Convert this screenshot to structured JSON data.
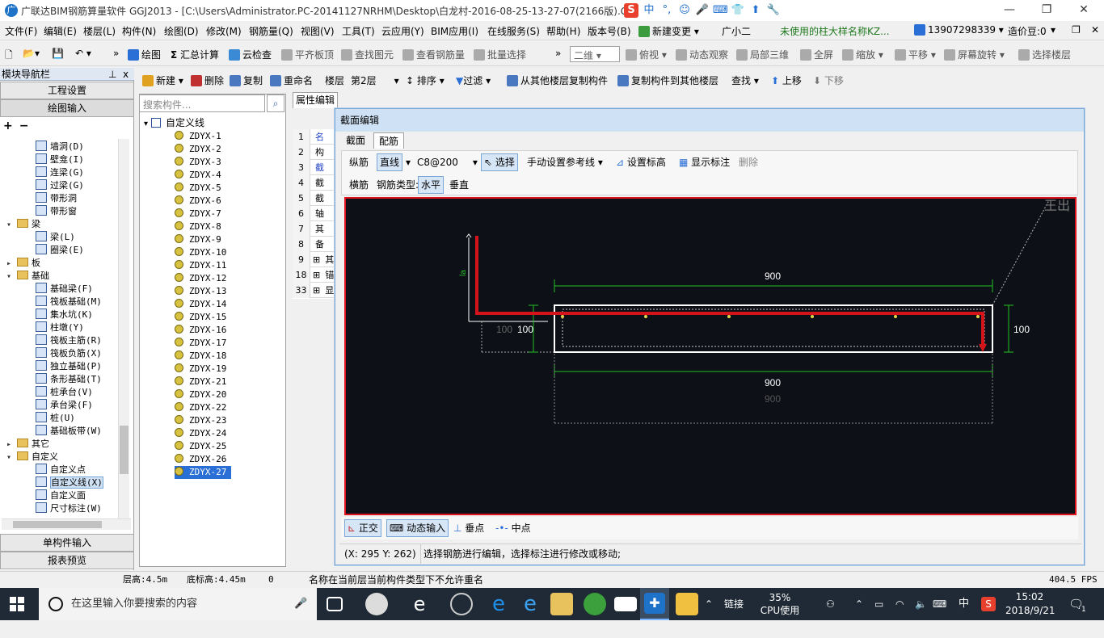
{
  "window": {
    "title": "广联达BIM钢筋算量软件 GGJ2013 - [C:\\Users\\Administrator.PC-20141127NRHM\\Desktop\\白龙村-2016-08-25-13-27-07(2166版).GGJ12]",
    "title_short": "广联达BIM钢筋算量软件 GGJ2013 - [C:\\Users\\Administrator.PC-20141127NRHM\\Desktop\\白龙村-2016-08-25-13-27-07(2166版).G",
    "minimize": "—",
    "restore": "❐",
    "close": "✕"
  },
  "ime": {
    "logo": "S",
    "mode": "中",
    "punct": "°,",
    "emoji": "☺",
    "voice": "🎤",
    "keyboard": "⌨",
    "skin": "👕",
    "tshirt": "⬆",
    "tool": "🔧"
  },
  "menu": [
    "文件(F)",
    "编辑(E)",
    "楼层(L)",
    "构件(N)",
    "绘图(D)",
    "修改(M)",
    "钢筋量(Q)",
    "视图(V)",
    "工具(T)",
    "云应用(Y)",
    "BIM应用(I)",
    "在线服务(S)",
    "帮助(H)",
    "版本号(B)"
  ],
  "menu_right": {
    "new_change": "新建变更",
    "assistant": "广小二",
    "notice": "未使用的柱大样名称KZ...",
    "phone": "13907298339",
    "price": "造价豆:0"
  },
  "toolbar1": {
    "draw": "绘图",
    "sum": "汇总计算",
    "cloud_check": "云检查",
    "level_slab": "平齐板顶",
    "find_elem": "查找图元",
    "view_rebar": "查看钢筋量",
    "batch_select": "批量选择",
    "view_mode": "二维",
    "top_view": "俯视",
    "dyn_view": "动态观察",
    "local_3d": "局部三维",
    "fullscreen": "全屏",
    "zoom": "缩放",
    "pan": "平移",
    "rotate": "屏幕旋转",
    "select_floor": "选择楼层"
  },
  "leftpanel": {
    "header": "模块导航栏",
    "pin": "ⅹ",
    "btn_project": "工程设置",
    "btn_draw": "绘图输入",
    "btn_single": "单构件输入",
    "btn_report": "报表预览",
    "tree": [
      {
        "label": "墙洞(D)",
        "level": 2
      },
      {
        "label": "壁龛(I)",
        "level": 2
      },
      {
        "label": "连梁(G)",
        "level": 2
      },
      {
        "label": "过梁(G)",
        "level": 2
      },
      {
        "label": "带形洞",
        "level": 2
      },
      {
        "label": "带形窗",
        "level": 2
      },
      {
        "label": "梁",
        "level": 1,
        "folder": true,
        "expanded": true
      },
      {
        "label": "梁(L)",
        "level": 2
      },
      {
        "label": "圈梁(E)",
        "level": 2
      },
      {
        "label": "板",
        "level": 1,
        "folder": true,
        "expanded": false
      },
      {
        "label": "基础",
        "level": 1,
        "folder": true,
        "expanded": true
      },
      {
        "label": "基础梁(F)",
        "level": 2
      },
      {
        "label": "筏板基础(M)",
        "level": 2
      },
      {
        "label": "集水坑(K)",
        "level": 2
      },
      {
        "label": "柱墩(Y)",
        "level": 2
      },
      {
        "label": "筏板主筋(R)",
        "level": 2
      },
      {
        "label": "筏板负筋(X)",
        "level": 2
      },
      {
        "label": "独立基础(P)",
        "level": 2
      },
      {
        "label": "条形基础(T)",
        "level": 2
      },
      {
        "label": "桩承台(V)",
        "level": 2
      },
      {
        "label": "承台梁(F)",
        "level": 2
      },
      {
        "label": "桩(U)",
        "level": 2
      },
      {
        "label": "基础板带(W)",
        "level": 2
      },
      {
        "label": "其它",
        "level": 1,
        "folder": true,
        "expanded": false
      },
      {
        "label": "自定义",
        "level": 1,
        "folder": true,
        "expanded": true
      },
      {
        "label": "自定义点",
        "level": 2
      },
      {
        "label": "自定义线(X)",
        "level": 2,
        "selected": true
      },
      {
        "label": "自定义面",
        "level": 2
      },
      {
        "label": "尺寸标注(W)",
        "level": 2
      }
    ]
  },
  "toolbar2": {
    "new": "新建",
    "delete": "删除",
    "copy": "复制",
    "rename": "重命名",
    "floor_label": "楼层",
    "floor_value": "第2层",
    "sort": "排序",
    "filter": "过滤",
    "copy_from": "从其他楼层复制构件",
    "copy_to": "复制构件到其他楼层",
    "find": "查找",
    "up": "上移",
    "down": "下移"
  },
  "components": {
    "search_placeholder": "搜索构件...",
    "root": "自定义线",
    "items": [
      "ZDYX-1",
      "ZDYX-2",
      "ZDYX-3",
      "ZDYX-4",
      "ZDYX-5",
      "ZDYX-6",
      "ZDYX-7",
      "ZDYX-8",
      "ZDYX-9",
      "ZDYX-10",
      "ZDYX-11",
      "ZDYX-12",
      "ZDYX-13",
      "ZDYX-14",
      "ZDYX-15",
      "ZDYX-16",
      "ZDYX-17",
      "ZDYX-18",
      "ZDYX-19",
      "ZDYX-21",
      "ZDYX-20",
      "ZDYX-22",
      "ZDYX-23",
      "ZDYX-24",
      "ZDYX-25",
      "ZDYX-26",
      "ZDYX-27"
    ],
    "selected": "ZDYX-27"
  },
  "props": {
    "tab": "属性编辑",
    "rows": [
      {
        "n": "1",
        "v": "名"
      },
      {
        "n": "2",
        "v": "构"
      },
      {
        "n": "3",
        "v": "截"
      },
      {
        "n": "4",
        "v": "截"
      },
      {
        "n": "5",
        "v": "截"
      },
      {
        "n": "6",
        "v": "轴"
      },
      {
        "n": "7",
        "v": "其"
      },
      {
        "n": "8",
        "v": "备"
      },
      {
        "n": "9",
        "v": "其"
      },
      {
        "n": "18",
        "v": "锚"
      },
      {
        "n": "33",
        "v": "显"
      }
    ]
  },
  "dialog": {
    "title": "截面编辑",
    "tab_section": "截面",
    "tab_rebar": "配筋",
    "long_rebar": "纵筋",
    "line": "直线",
    "spec": "C8@200",
    "select": "选择",
    "manual_ref": "手动设置参考线",
    "set_height": "设置标高",
    "show_mark": "显示标注",
    "del": "删除",
    "stirrup": "横筋",
    "rebar_type_label": "钢筋类型:",
    "horizontal": "水平",
    "vertical": "垂直",
    "ortho": "正交",
    "dyn_input": "动态输入",
    "perp": "垂点",
    "mid": "中点",
    "coord": "(X: 295 Y: 262)",
    "hint": "选择钢筋进行编辑，选择标注进行修改或移动;"
  },
  "canvas": {
    "dim_top": "900",
    "dim_bottom": "900",
    "dim_bottom2": "900",
    "dim_left_a": "100",
    "dim_left_b": "100",
    "dim_right": "100",
    "la": "la",
    "corner_text": "王出"
  },
  "statusbar": {
    "floor_height": "层高:4.5m",
    "base_height": "底标高:4.45m",
    "zero": "0",
    "message": "名称在当前层当前构件类型下不允许重名",
    "fps": "404.5 FPS"
  },
  "taskbar": {
    "search": "在这里输入你要搜索的内容",
    "link": "链接",
    "cpu_pct": "35%",
    "cpu_label": "CPU使用",
    "lang": "中",
    "time": "15:02",
    "date": "2018/9/21",
    "notif": "1"
  },
  "colors": {
    "rebar": "#d4141a",
    "dim": "#24c224",
    "frame": "#ffffff",
    "canvas_bg": "#0d1017",
    "accent": "#2a6fd6"
  }
}
